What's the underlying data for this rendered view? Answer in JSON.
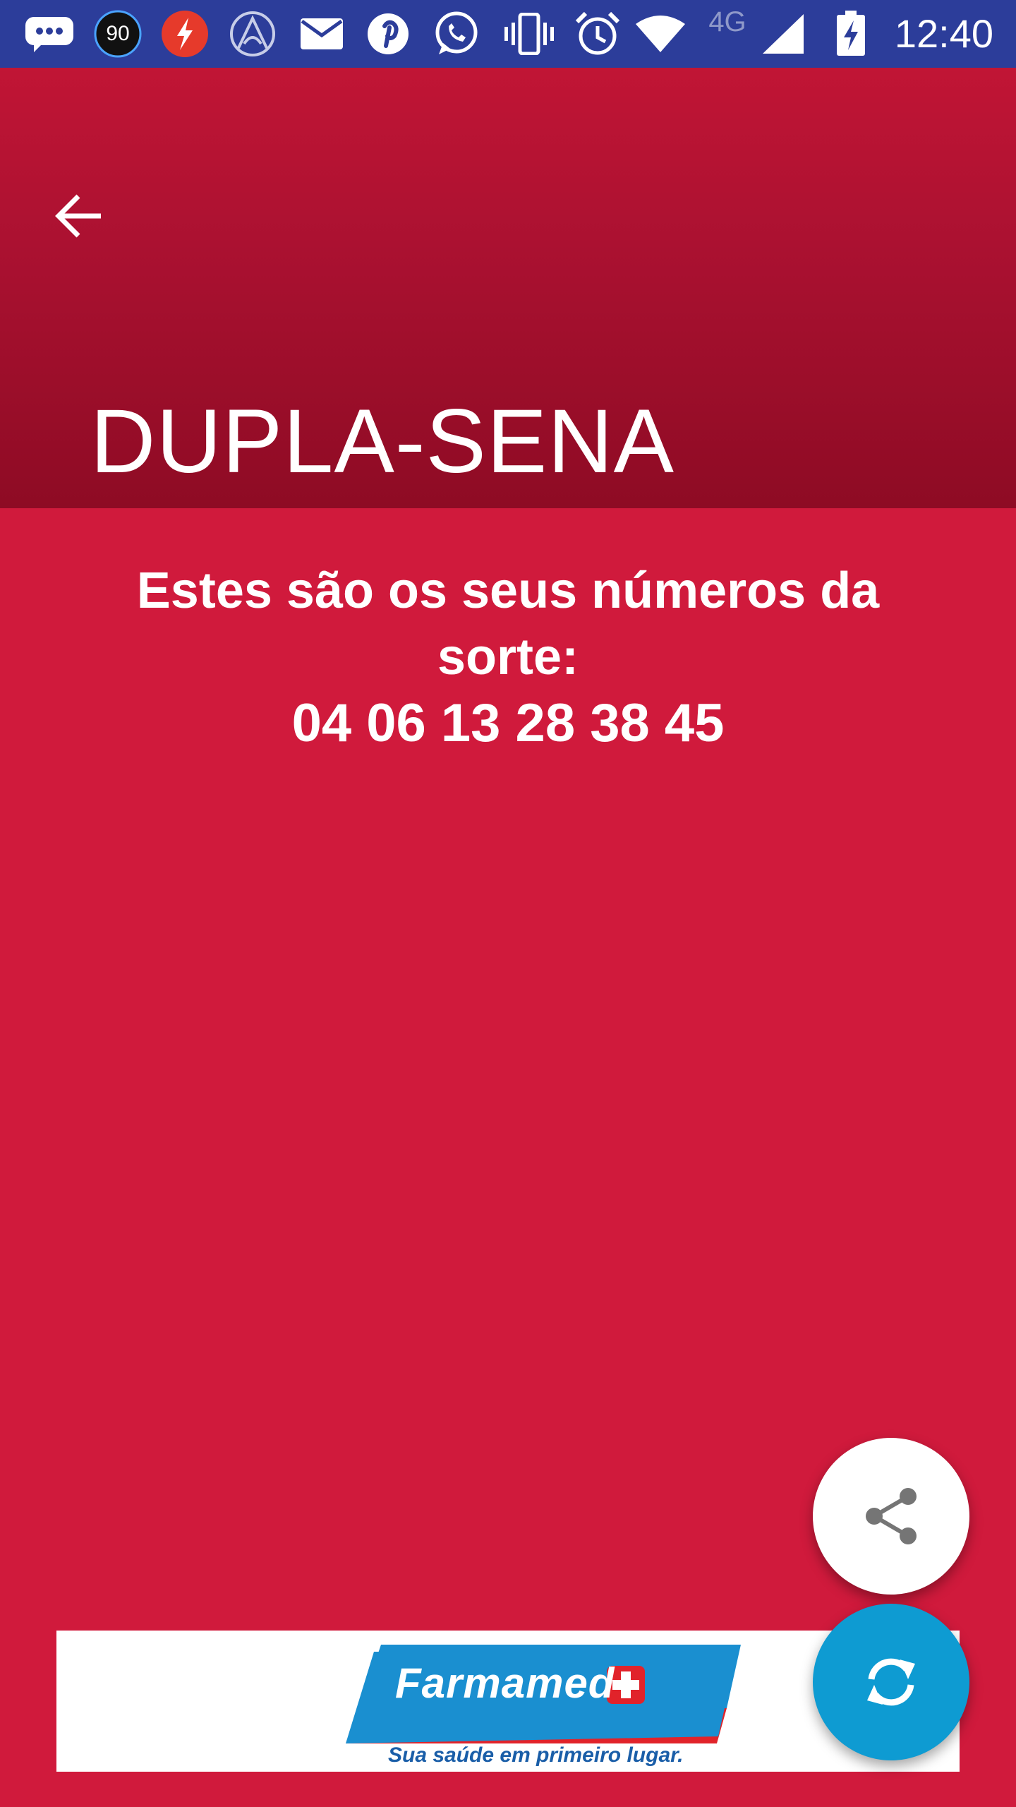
{
  "status_bar": {
    "time": "12:40",
    "badge_number": "90",
    "network_label": "4G",
    "icons": [
      "chat-bubble-icon",
      "number-badge-icon",
      "flash-app-icon",
      "arc-app-icon",
      "mail-icon",
      "pinterest-icon",
      "whatsapp-icon",
      "vibrate-icon",
      "alarm-icon",
      "wifi-icon",
      "cell-signal-icon",
      "battery-charging-icon"
    ],
    "color": "#2c3d9a"
  },
  "app_bar": {
    "title": "DUPLA-SENA",
    "back_icon": "arrow-back-icon",
    "color": "#ab1131"
  },
  "content": {
    "heading": "Estes são os seus números da sorte:",
    "numbers": "04 06 13 28 38 45",
    "background_color": "#d01a3c"
  },
  "fabs": {
    "share_icon": "share-icon",
    "refresh_icon": "refresh-icon",
    "refresh_color": "#0e9bd2"
  },
  "ad": {
    "brand": "Farmamed",
    "tagline": "Sua saúde em primeiro lugar."
  }
}
